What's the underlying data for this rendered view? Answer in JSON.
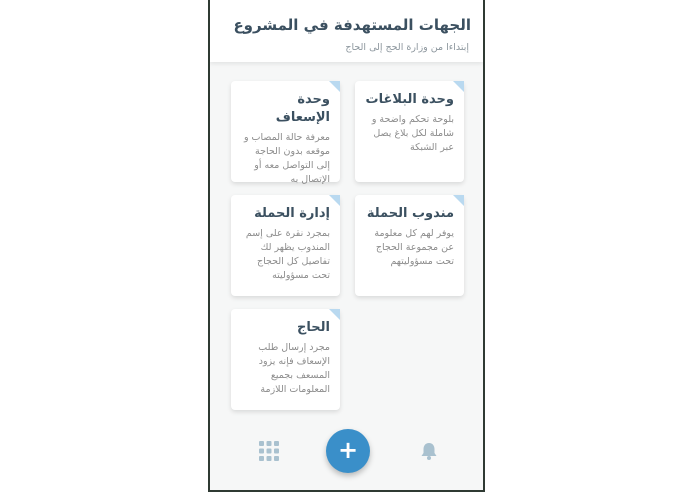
{
  "header": {
    "title": "الجهات المستهدفة في المشروع",
    "subtitle": "إبتداءا من وزارة الحج إلى الحاج"
  },
  "cards": [
    {
      "title": "وحدة البلاغات",
      "desc": "بلوحة تحكم واضحة و شاملة لكل بلاغ يصل عبر الشبكة"
    },
    {
      "title": "وحدة الإسعاف",
      "desc": "معرفة حالة المصاب و موقعه بدون الحاجة إلى التواصل معه أو الإتصال به"
    },
    {
      "title": "مندوب الحملة",
      "desc": "يوفر لهم كل معلومة عن مجموعة الحجاج تحت مسؤوليتهم"
    },
    {
      "title": "إدارة الحملة",
      "desc": "بمجرد نقرة على إسم المندوب يظهر لك تفاصيل كل الحجاج تحت مسؤوليته"
    },
    {
      "title": "الحاج",
      "desc": "مجرد إرسال طلب الإسعاف فإنه يزود المسعف بجميع المعلومات اللازمة"
    }
  ],
  "toolbar": {
    "fab_label": "+",
    "left_icon": "grid-icon",
    "right_icon": "bell-icon"
  },
  "colors": {
    "accent": "#3a8fc9",
    "title": "#3b5060",
    "fold": "#b9d9f0"
  }
}
